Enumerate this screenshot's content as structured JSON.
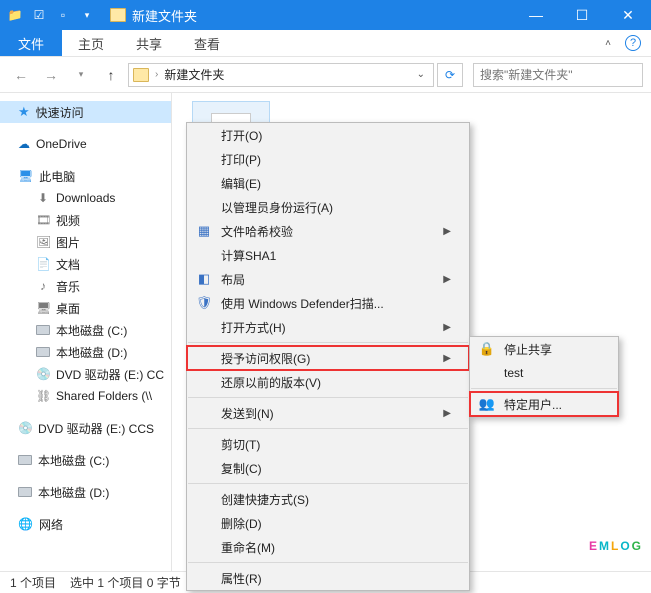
{
  "window": {
    "title": "新建文件夹"
  },
  "ribbon": {
    "file": "文件",
    "tabs": [
      "主页",
      "共享",
      "查看"
    ]
  },
  "nav": {
    "breadcrumb": "新建文件夹",
    "search_placeholder": "搜索\"新建文件夹\""
  },
  "sidebar": {
    "quick": "快速访问",
    "onedrive": "OneDrive",
    "thispc": "此电脑",
    "items": [
      "Downloads",
      "视频",
      "图片",
      "文档",
      "音乐",
      "桌面",
      "本地磁盘 (C:)",
      "本地磁盘 (D:)",
      "DVD 驱动器 (E:) CC",
      "Shared Folders (\\\\"
    ],
    "outside": [
      "DVD 驱动器 (E:) CCS",
      "本地磁盘 (C:)",
      "本地磁盘 (D:)"
    ],
    "network": "网络"
  },
  "status": {
    "count": "1 个项目",
    "selection": "选中 1 个项目  0 字节"
  },
  "context": {
    "open": "打开(O)",
    "print": "打印(P)",
    "edit": "编辑(E)",
    "admin": "以管理员身份运行(A)",
    "hash": "文件哈希校验",
    "sha1": "计算SHA1",
    "layout": "布局",
    "defender": "使用 Windows Defender扫描...",
    "openwith": "打开方式(H)",
    "grant": "授予访问权限(G)",
    "restore": "还原以前的版本(V)",
    "sendto": "发送到(N)",
    "cut": "剪切(T)",
    "copy": "复制(C)",
    "shortcut": "创建快捷方式(S)",
    "delete": "删除(D)",
    "rename": "重命名(M)",
    "props": "属性(R)"
  },
  "submenu": {
    "stopshare": "停止共享",
    "test": "test",
    "specific": "特定用户..."
  },
  "watermark": "EMLOG"
}
